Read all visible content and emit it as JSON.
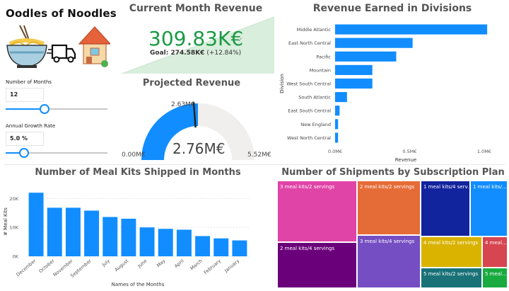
{
  "brand": {
    "title": "Oodles of Noodles"
  },
  "slicers": {
    "months": {
      "label": "Number of Months",
      "value": "12",
      "fraction": 0.38
    },
    "growth": {
      "label": "Annual Growth Rate",
      "value": "5.0 %",
      "fraction": 0.18
    }
  },
  "revenue_card": {
    "title": "Current Month Revenue",
    "value": "309.83K€",
    "goal_label": "Goal: 274.58K€",
    "goal_delta": "(+12.84%)",
    "accent": "#1a9a44"
  },
  "projected": {
    "title": "Projected Revenue",
    "value": "2.76M€",
    "min_label": "0.00M€",
    "max_label": "5.52M€",
    "target_label": "2.63M€",
    "min": 0,
    "max": 5.52,
    "current": 2.76,
    "target": 2.63,
    "color": "#118dff"
  },
  "divisions_chart": {
    "title": "Revenue Earned in Divisions",
    "chart_data": {
      "type": "bar",
      "orientation": "horizontal",
      "xlabel": "Revenue",
      "ylabel": "Division",
      "categories": [
        "Middle Atlantic",
        "East North Central",
        "Pacific",
        "Mountain",
        "West South Central",
        "South Atlantic",
        "East South Central",
        "New England",
        "West North Central"
      ],
      "values": [
        1.02,
        0.52,
        0.41,
        0.25,
        0.25,
        0.08,
        0.03,
        0.02,
        0.02
      ],
      "xlim": [
        0,
        1.1
      ],
      "ticks": [
        {
          "value": 0,
          "label": "0.0M€"
        },
        {
          "value": 0.5,
          "label": "0.5M€"
        },
        {
          "value": 1.0,
          "label": "1.0M€"
        }
      ],
      "color": "#118dff"
    }
  },
  "mealkits_chart": {
    "title": "Number of Meal Kits Shipped in Months",
    "chart_data": {
      "type": "bar",
      "xlabel": "Names of the Months",
      "ylabel": "# Meal Kits",
      "categories": [
        "December",
        "October",
        "November",
        "September",
        "July",
        "August",
        "June",
        "May",
        "April",
        "March",
        "February",
        "January"
      ],
      "values": [
        22000,
        16800,
        16800,
        15800,
        13600,
        13000,
        10000,
        9500,
        9200,
        7000,
        6200,
        5500
      ],
      "ylim": [
        0,
        24000
      ],
      "ticks": [
        {
          "value": 0,
          "label": "0K"
        },
        {
          "value": 10000,
          "label": "10K"
        },
        {
          "value": 20000,
          "label": "20K"
        }
      ],
      "grid": true,
      "color": "#118dff"
    }
  },
  "subscription_chart": {
    "title": "Number of Shipments by Subscription Plan",
    "chart_data": {
      "type": "treemap",
      "items": [
        {
          "label": "3 meal kits/2 servings",
          "color": "#e044a7"
        },
        {
          "label": "2 meal kits/4 servings",
          "color": "#6b007b"
        },
        {
          "label": "2 meal kits/2 servings",
          "color": "#e66c37"
        },
        {
          "label": "3 meal kits/4 servings",
          "color": "#744ec2"
        },
        {
          "label": "1 meal kits/4 serv...",
          "color": "#12239e"
        },
        {
          "label": "1 meal kits/...",
          "color": "#118dff"
        },
        {
          "label": "4 meal kits/2 servings",
          "color": "#d9b300"
        },
        {
          "label": "4 meal...",
          "color": "#d64550"
        },
        {
          "label": "5 meal kits/2 servings",
          "color": "#197278"
        },
        {
          "label": "5 meal...",
          "color": "#1aab40"
        }
      ]
    }
  }
}
